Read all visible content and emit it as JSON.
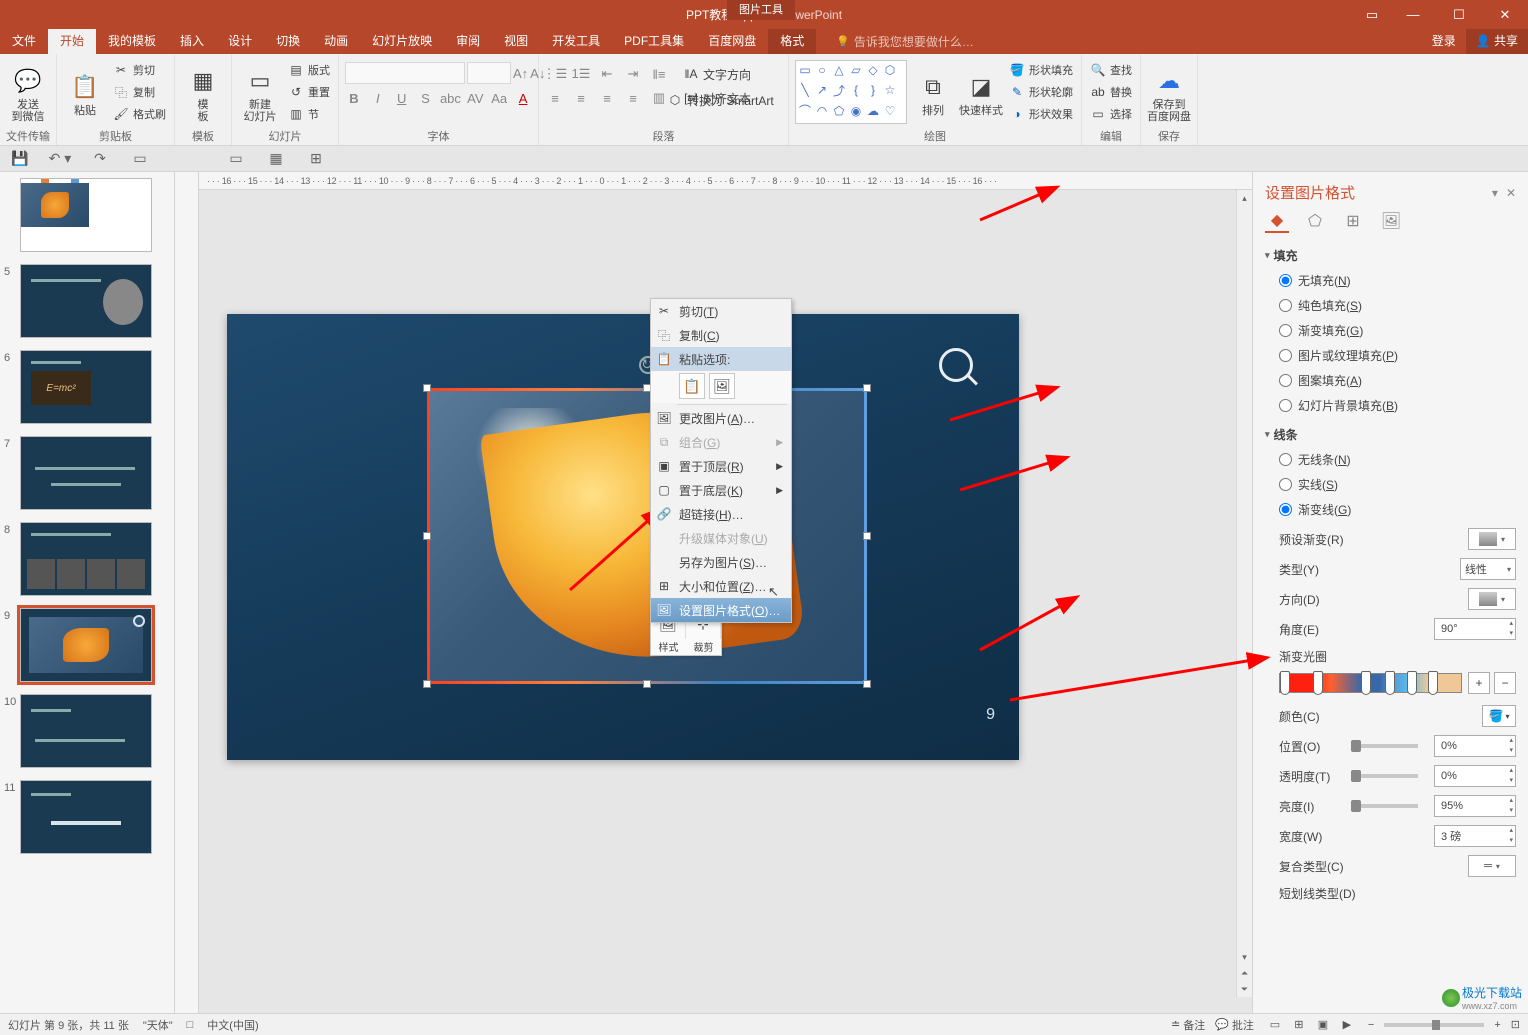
{
  "titlebar": {
    "filename": "PPT教程2.pptx",
    "appname": "- PowerPoint",
    "picture_tools": "图片工具"
  },
  "menubar": {
    "tabs": [
      "文件",
      "开始",
      "我的模板",
      "插入",
      "设计",
      "切换",
      "动画",
      "幻灯片放映",
      "审阅",
      "视图",
      "开发工具",
      "PDF工具集",
      "百度网盘",
      "格式"
    ],
    "tell_me": "告诉我您想要做什么…",
    "login": "登录",
    "share": "共享"
  },
  "ribbon": {
    "groups": {
      "file_transfer": {
        "label": "文件传输",
        "btn": "发送\n到微信"
      },
      "clipboard": {
        "label": "剪贴板",
        "paste": "粘贴",
        "cut": "剪切",
        "copy": "复制",
        "format_painter": "格式刷"
      },
      "template": {
        "label": "模板",
        "btn": "模\n板"
      },
      "slides": {
        "label": "幻灯片",
        "new_slide": "新建\n幻灯片",
        "layout": "版式",
        "reset": "重置",
        "section": "节"
      },
      "font": {
        "label": "字体"
      },
      "paragraph": {
        "label": "段落",
        "text_dir": "文字方向",
        "align_text": "对齐文本",
        "smartart": "转换为 SmartArt"
      },
      "drawing": {
        "label": "绘图",
        "arrange": "排列",
        "quick_styles": "快速样式",
        "shape_fill": "形状填充",
        "shape_outline": "形状轮廓",
        "shape_effects": "形状效果"
      },
      "editing": {
        "label": "编辑",
        "find": "查找",
        "replace": "替换",
        "select": "选择"
      },
      "save": {
        "label": "保存",
        "btn": "保存到\n百度网盘"
      }
    }
  },
  "ruler_text": "· · · 16 · · · 15 · · · 14 · · · 13 · · · 12 · · · 11 · · · 10 · · · 9 · · · 8 · · · 7 · · · 6 · · · 5 · · · 4 · · · 3 · · · 2 · · · 1 · · · 0 · · · 1 · · · 2 · · · 3 · · · 4 · · · 5 · · · 6 · · · 7 · · · 8 · · · 9 · · · 10 · · · 11 · · · 12 · · · 13 · · · 14 · · · 15 · · · 16 · · ·",
  "thumbs": [
    {
      "num": "",
      "type": "chart"
    },
    {
      "num": "5",
      "type": "einstein"
    },
    {
      "num": "6",
      "type": "emc"
    },
    {
      "num": "7",
      "type": "text"
    },
    {
      "num": "8",
      "type": "photos"
    },
    {
      "num": "9",
      "type": "leaf",
      "selected": true
    },
    {
      "num": "10",
      "type": "text2"
    },
    {
      "num": "11",
      "type": "text3"
    }
  ],
  "slide": {
    "number": "9"
  },
  "context_menu": {
    "cut": "剪切(T)",
    "copy": "复制(C)",
    "paste_options_label": "粘贴选项:",
    "change_picture": "更改图片(A)…",
    "group": "组合(G)",
    "bring_front": "置于顶层(R)",
    "send_back": "置于底层(K)",
    "hyperlink": "超链接(H)…",
    "upgrade_media": "升级媒体对象(U)",
    "save_as_picture": "另存为图片(S)…",
    "size_position": "大小和位置(Z)…",
    "format_picture": "设置图片格式(O)…"
  },
  "mini_toolbar": {
    "style": "样式",
    "crop": "裁剪"
  },
  "format_pane": {
    "title": "设置图片格式",
    "sections": {
      "fill": {
        "title": "填充",
        "options": {
          "none": "无填充(N)",
          "solid": "纯色填充(S)",
          "gradient": "渐变填充(G)",
          "picture": "图片或纹理填充(P)",
          "pattern": "图案填充(A)",
          "slide_bg": "幻灯片背景填充(B)"
        },
        "selected": "none"
      },
      "line": {
        "title": "线条",
        "options": {
          "none": "无线条(N)",
          "solid": "实线(S)",
          "gradient": "渐变线(G)"
        },
        "selected": "gradient",
        "preset": {
          "label": "预设渐变(R)"
        },
        "type": {
          "label": "类型(Y)",
          "value": "线性"
        },
        "direction": {
          "label": "方向(D)"
        },
        "angle": {
          "label": "角度(E)",
          "value": "90°"
        },
        "gradient_stops": {
          "label": "渐变光圈"
        },
        "color": {
          "label": "颜色(C)"
        },
        "position": {
          "label": "位置(O)",
          "value": "0%"
        },
        "transparency": {
          "label": "透明度(T)",
          "value": "0%"
        },
        "brightness": {
          "label": "亮度(I)",
          "value": "95%"
        },
        "width": {
          "label": "宽度(W)",
          "value": "3 磅"
        },
        "compound": {
          "label": "复合类型(C)"
        },
        "dash": {
          "label": "短划线类型(D)"
        }
      }
    }
  },
  "statusbar": {
    "slide_info": "幻灯片 第 9 张，共 11 张",
    "theme": "\"天体\"",
    "lang": "中文(中国)",
    "notes": "备注",
    "comments": "批注",
    "zoom_minus": "−",
    "zoom_plus": "+"
  },
  "watermark": {
    "name": "极光下载站",
    "url": "www.xz7.com"
  }
}
